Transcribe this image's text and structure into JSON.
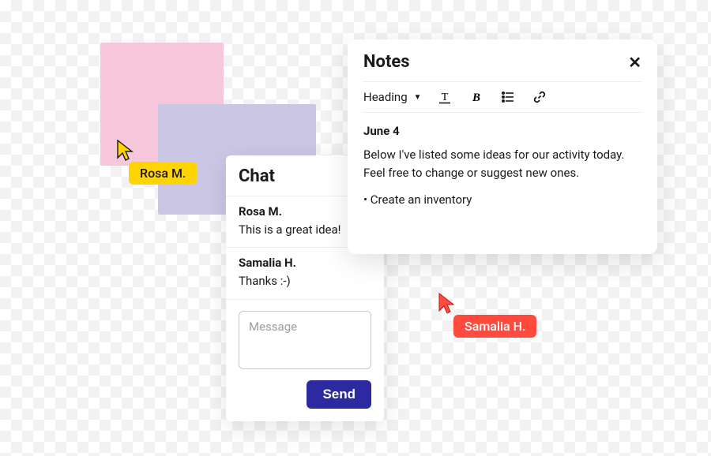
{
  "cursors": {
    "rosa": {
      "label": "Rosa M.",
      "color": "#ffd400"
    },
    "samalia": {
      "label": "Samalia H.",
      "color": "#ff4a3d"
    }
  },
  "chat": {
    "title": "Chat",
    "messages": [
      {
        "author": "Rosa M.",
        "text": "This is a great idea!"
      },
      {
        "author": "Samalia H.",
        "text": "Thanks :-)"
      }
    ],
    "compose_placeholder": "Message",
    "send_label": "Send"
  },
  "notes": {
    "title": "Notes",
    "toolbar": {
      "style_select": "Heading",
      "icons": [
        "underline-icon",
        "bold-icon",
        "list-icon",
        "link-icon"
      ]
    },
    "date": "June 4",
    "body": "Below I've listed some ideas for our activity today. Feel free to change or suggest new ones.",
    "bullets": [
      "Create an inventory"
    ]
  }
}
